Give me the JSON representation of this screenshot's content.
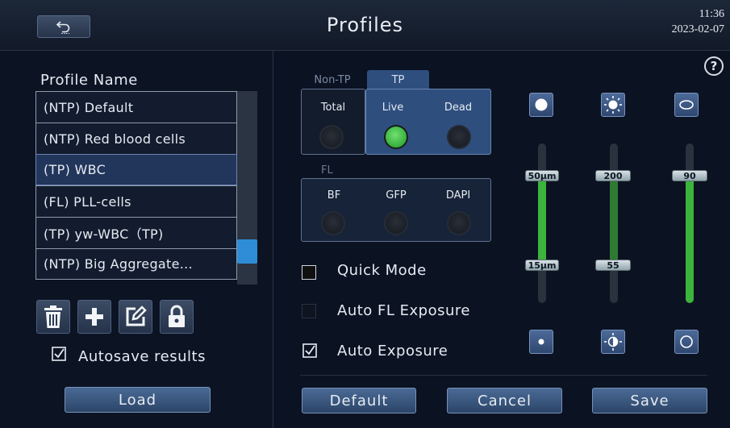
{
  "header": {
    "title": "Profiles",
    "time": "11:36",
    "date": "2023-02-07",
    "back_icon": "back-arrow-icon"
  },
  "profiles": {
    "label": "Profile Name",
    "items": [
      {
        "label": "(NTP) Default"
      },
      {
        "label": "(NTP) Red blood cells"
      },
      {
        "label": "(TP) WBC",
        "selected": true
      },
      {
        "label": "(FL) PLL-cells"
      },
      {
        "label": "(TP) yw-WBC（TP)"
      },
      {
        "label": "(NTP) Big Aggregate..."
      }
    ],
    "tools": [
      "trash-icon",
      "plus-icon",
      "edit-icon",
      "lock-icon"
    ],
    "autosave_label": "Autosave results",
    "autosave_checked": true,
    "load_label": "Load"
  },
  "settings": {
    "tab_non_tp": "Non-TP",
    "tab_tp": "TP",
    "tp_channels": {
      "total": "Total",
      "live": "Live",
      "dead": "Dead"
    },
    "fl_label": "FL",
    "fl_channels": {
      "bf": "BF",
      "gfp": "GFP",
      "dapi": "DAPI"
    },
    "quick_mode_label": "Quick Mode",
    "quick_mode_checked": false,
    "auto_fl_label": "Auto FL Exposure",
    "auto_fl_checked": false,
    "auto_exposure_label": "Auto Exposure",
    "auto_exposure_checked": true,
    "help_label": "?"
  },
  "sliders": {
    "size": {
      "max_label": "50µm",
      "min_label": "15µm",
      "top_icon": "large-dot-icon",
      "bottom_icon": "small-dot-icon"
    },
    "brightness": {
      "max_label": "200",
      "min_label": "55",
      "top_icon": "brightness-icon",
      "bottom_icon": "contrast-icon"
    },
    "circularity": {
      "max_label": "90",
      "top_icon": "ellipse-icon",
      "bottom_icon": "circle-icon"
    }
  },
  "actions": {
    "default_label": "Default",
    "cancel_label": "Cancel",
    "save_label": "Save"
  }
}
